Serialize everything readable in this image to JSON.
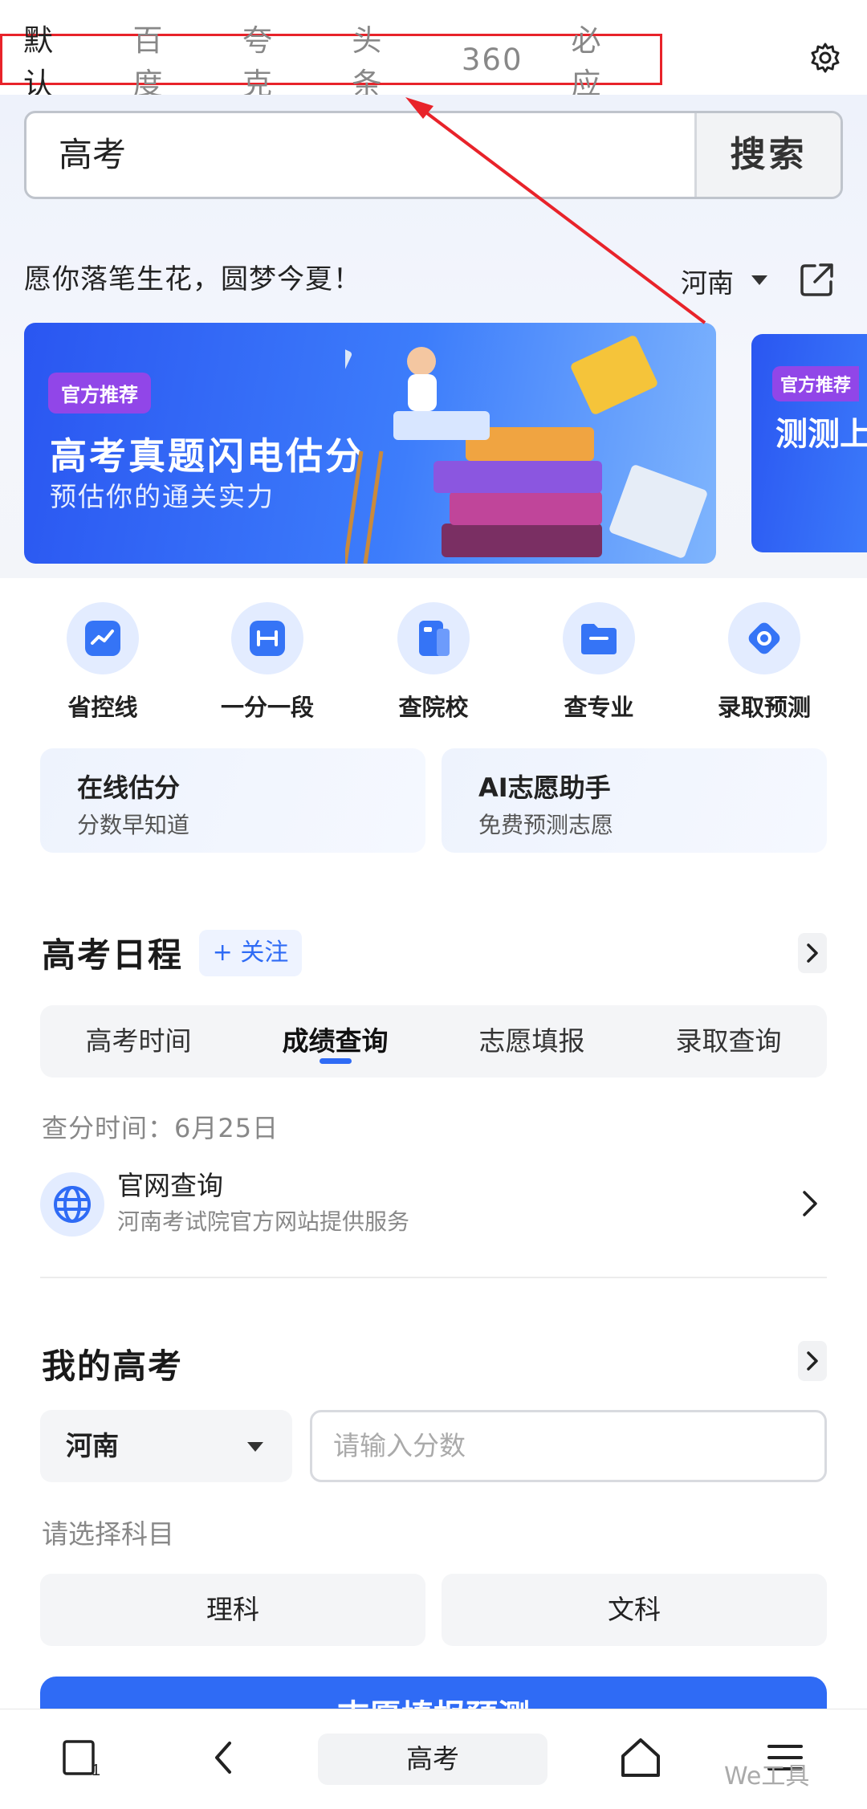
{
  "engines": {
    "tabs": [
      "默认",
      "百度",
      "夸克",
      "头条",
      "360",
      "必应"
    ],
    "active_index": 0
  },
  "search": {
    "query": "高考",
    "button_label": "搜索"
  },
  "header": {
    "slogan": "愿你落笔生花，圆梦今夏！",
    "region": "河南"
  },
  "banners": [
    {
      "tag": "官方推荐",
      "title": "高考真题闪电估分",
      "subtitle": "预估你的通关实力"
    },
    {
      "tag": "官方推荐",
      "title": "测测上什"
    }
  ],
  "quick_actions": [
    {
      "label": "省控线",
      "icon": "trend-icon"
    },
    {
      "label": "一分一段",
      "icon": "segment-icon"
    },
    {
      "label": "查院校",
      "icon": "school-icon"
    },
    {
      "label": "查专业",
      "icon": "folder-icon"
    },
    {
      "label": "录取预测",
      "icon": "target-icon"
    }
  ],
  "tools": [
    {
      "title": "在线估分",
      "subtitle": "分数早知道"
    },
    {
      "title": "AI志愿助手",
      "subtitle": "免费预测志愿"
    }
  ],
  "schedule": {
    "title": "高考日程",
    "follow_label": "+ 关注",
    "tabs": [
      "高考时间",
      "成绩查询",
      "志愿填报",
      "录取查询"
    ],
    "active_tab": 1,
    "query_time": "查分时间：6月25日",
    "site": {
      "title": "官网查询",
      "subtitle": "河南考试院官方网站提供服务"
    }
  },
  "my_gaokao": {
    "title": "我的高考",
    "province": "河南",
    "score_placeholder": "请输入分数",
    "subject_hint": "请选择科目",
    "subjects": [
      "理科",
      "文科"
    ],
    "predict_label": "志愿填报预测"
  },
  "bottom_nav": {
    "tab_count": "1",
    "center_label": "高考",
    "watermark": "We工具"
  },
  "colors": {
    "accent": "#2f6bf5",
    "tag_purple": "#9146e8",
    "annotation_red": "#e8232a"
  }
}
